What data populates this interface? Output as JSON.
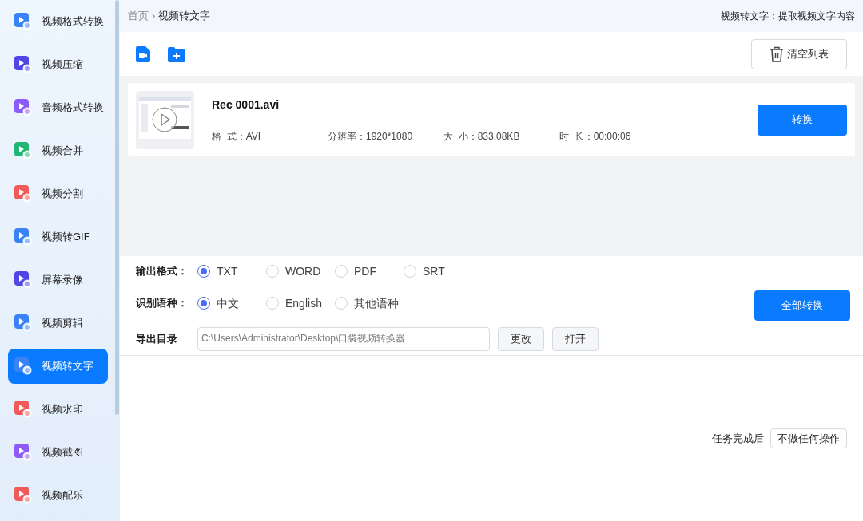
{
  "sidebar": {
    "items": [
      {
        "label": "视频格式转换",
        "color": "#3b82f6",
        "selected": false
      },
      {
        "label": "视频压缩",
        "color": "#4f46e5",
        "selected": false
      },
      {
        "label": "音频格式转换",
        "color": "#8b5cf6",
        "selected": false
      },
      {
        "label": "视频合并",
        "color": "#22b573",
        "selected": false
      },
      {
        "label": "视频分割",
        "color": "#f25a5a",
        "selected": false
      },
      {
        "label": "视频转GIF",
        "color": "#3b82f6",
        "selected": false
      },
      {
        "label": "屏幕录像",
        "color": "#4f46e5",
        "selected": false
      },
      {
        "label": "视频剪辑",
        "color": "#3b82f6",
        "selected": false
      },
      {
        "label": "视频转文字",
        "color": "#3b82f6",
        "selected": true
      },
      {
        "label": "视频水印",
        "color": "#f25a5a",
        "selected": false
      },
      {
        "label": "视频截图",
        "color": "#8b5cf6",
        "selected": false
      },
      {
        "label": "视频配乐",
        "color": "#f25a5a",
        "selected": false
      }
    ]
  },
  "breadcrumb": {
    "home": "首页",
    "separator": "›",
    "current": "视频转文字"
  },
  "header_hint": "视频转文字：提取视频文字内容",
  "toolbar": {
    "clear_button": "清空列表"
  },
  "files": [
    {
      "name": "Rec 0001.avi",
      "details": [
        "格  式：AVI",
        "分辨率：1920*1080",
        "大  小：833.08KB",
        "时  长：00:00:06"
      ],
      "action": "转换"
    }
  ],
  "options": [
    {
      "label": "输出格式：",
      "choices": [
        {
          "label": "TXT",
          "selected": true
        },
        {
          "label": "WORD",
          "selected": false
        },
        {
          "label": "PDF",
          "selected": false
        },
        {
          "label": "SRT",
          "selected": false
        }
      ]
    },
    {
      "label": "识别语种：",
      "choices": [
        {
          "label": "中文",
          "selected": true
        },
        {
          "label": "English",
          "selected": false
        },
        {
          "label": "其他语种",
          "selected": false
        }
      ]
    }
  ],
  "output_dir": {
    "label": "导出目录",
    "value": "C:\\Users\\Administrator\\Desktop\\口袋视频转换器",
    "change": "更改",
    "open": "打开"
  },
  "convert_all": "全部转换",
  "footer": {
    "label": "任务完成后",
    "option": "不做任何操作"
  }
}
